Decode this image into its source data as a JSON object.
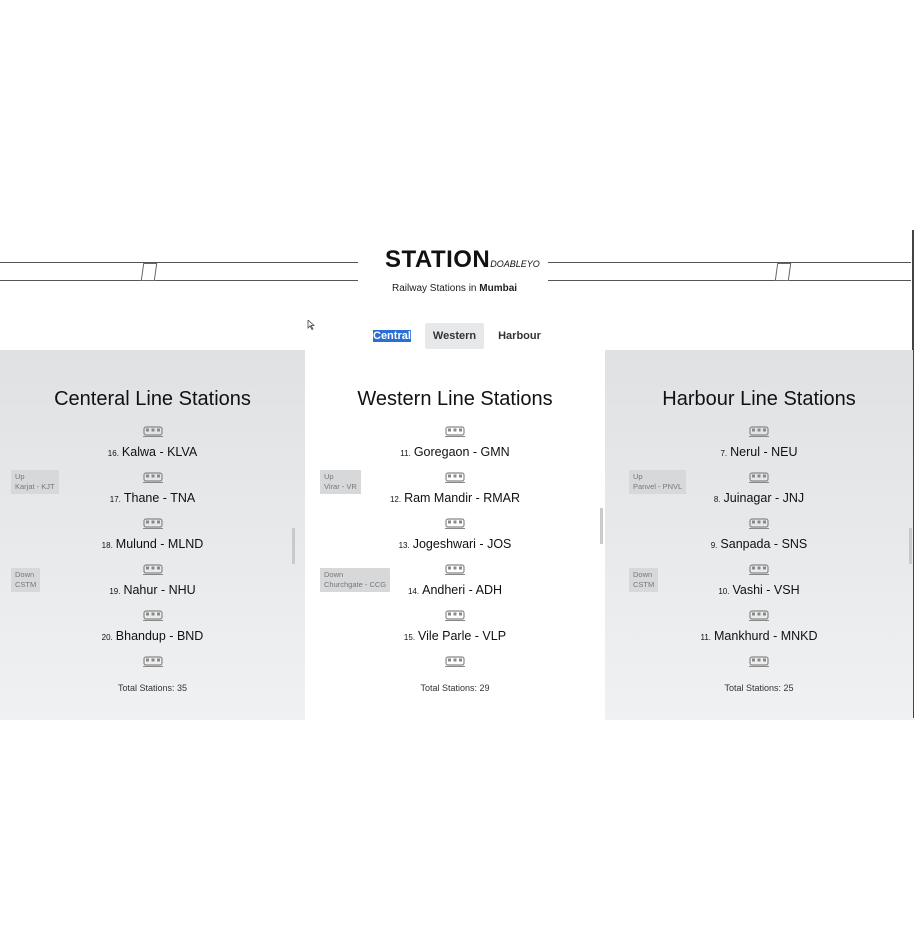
{
  "header": {
    "title": "STATION",
    "brand_suffix": "DOABLEYO",
    "subtitle_prefix": "Railway Stations in",
    "subtitle_city": "Mumbai"
  },
  "tabs": [
    {
      "label": "Central",
      "selected": true
    },
    {
      "label": "Western",
      "selected": false
    },
    {
      "label": "Harbour",
      "selected": false
    }
  ],
  "lines": [
    {
      "title": "Centeral Line Stations",
      "up": [
        "Up",
        "Karjat - KJT"
      ],
      "down": [
        "Down",
        "CSTM"
      ],
      "stations": [
        {
          "num": "16.",
          "name": "Kalwa - KLVA"
        },
        {
          "num": "17.",
          "name": "Thane - TNA"
        },
        {
          "num": "18.",
          "name": "Mulund - MLND"
        },
        {
          "num": "19.",
          "name": "Nahur - NHU"
        },
        {
          "num": "20.",
          "name": "Bhandup - BND"
        }
      ],
      "total": "Total Stations: 35"
    },
    {
      "title": "Western Line Stations",
      "up": [
        "Up",
        "Virar - VR"
      ],
      "down": [
        "Down",
        "Churchgate - CCG"
      ],
      "stations": [
        {
          "num": "11.",
          "name": "Goregaon - GMN"
        },
        {
          "num": "12.",
          "name": "Ram Mandir - RMAR"
        },
        {
          "num": "13.",
          "name": "Jogeshwari - JOS"
        },
        {
          "num": "14.",
          "name": "Andheri - ADH"
        },
        {
          "num": "15.",
          "name": "Vile Parle - VLP"
        }
      ],
      "total": "Total Stations: 29"
    },
    {
      "title": "Harbour Line Stations",
      "up": [
        "Up",
        "Panvel - PNVL"
      ],
      "down": [
        "Down",
        "CSTM"
      ],
      "stations": [
        {
          "num": "7.",
          "name": "Nerul - NEU"
        },
        {
          "num": "8.",
          "name": "Juinagar - JNJ"
        },
        {
          "num": "9.",
          "name": "Sanpada - SNS"
        },
        {
          "num": "10.",
          "name": "Vashi - VSH"
        },
        {
          "num": "11.",
          "name": "Mankhurd - MNKD"
        }
      ],
      "total": "Total Stations: 25"
    }
  ],
  "icons": {
    "train": "train-icon",
    "rail": "rail-track-icon",
    "cursor": "mouse-cursor-icon"
  },
  "colors": {
    "selected_tab": "#2a6fd6",
    "panel_grey": "#dfe1e3"
  }
}
